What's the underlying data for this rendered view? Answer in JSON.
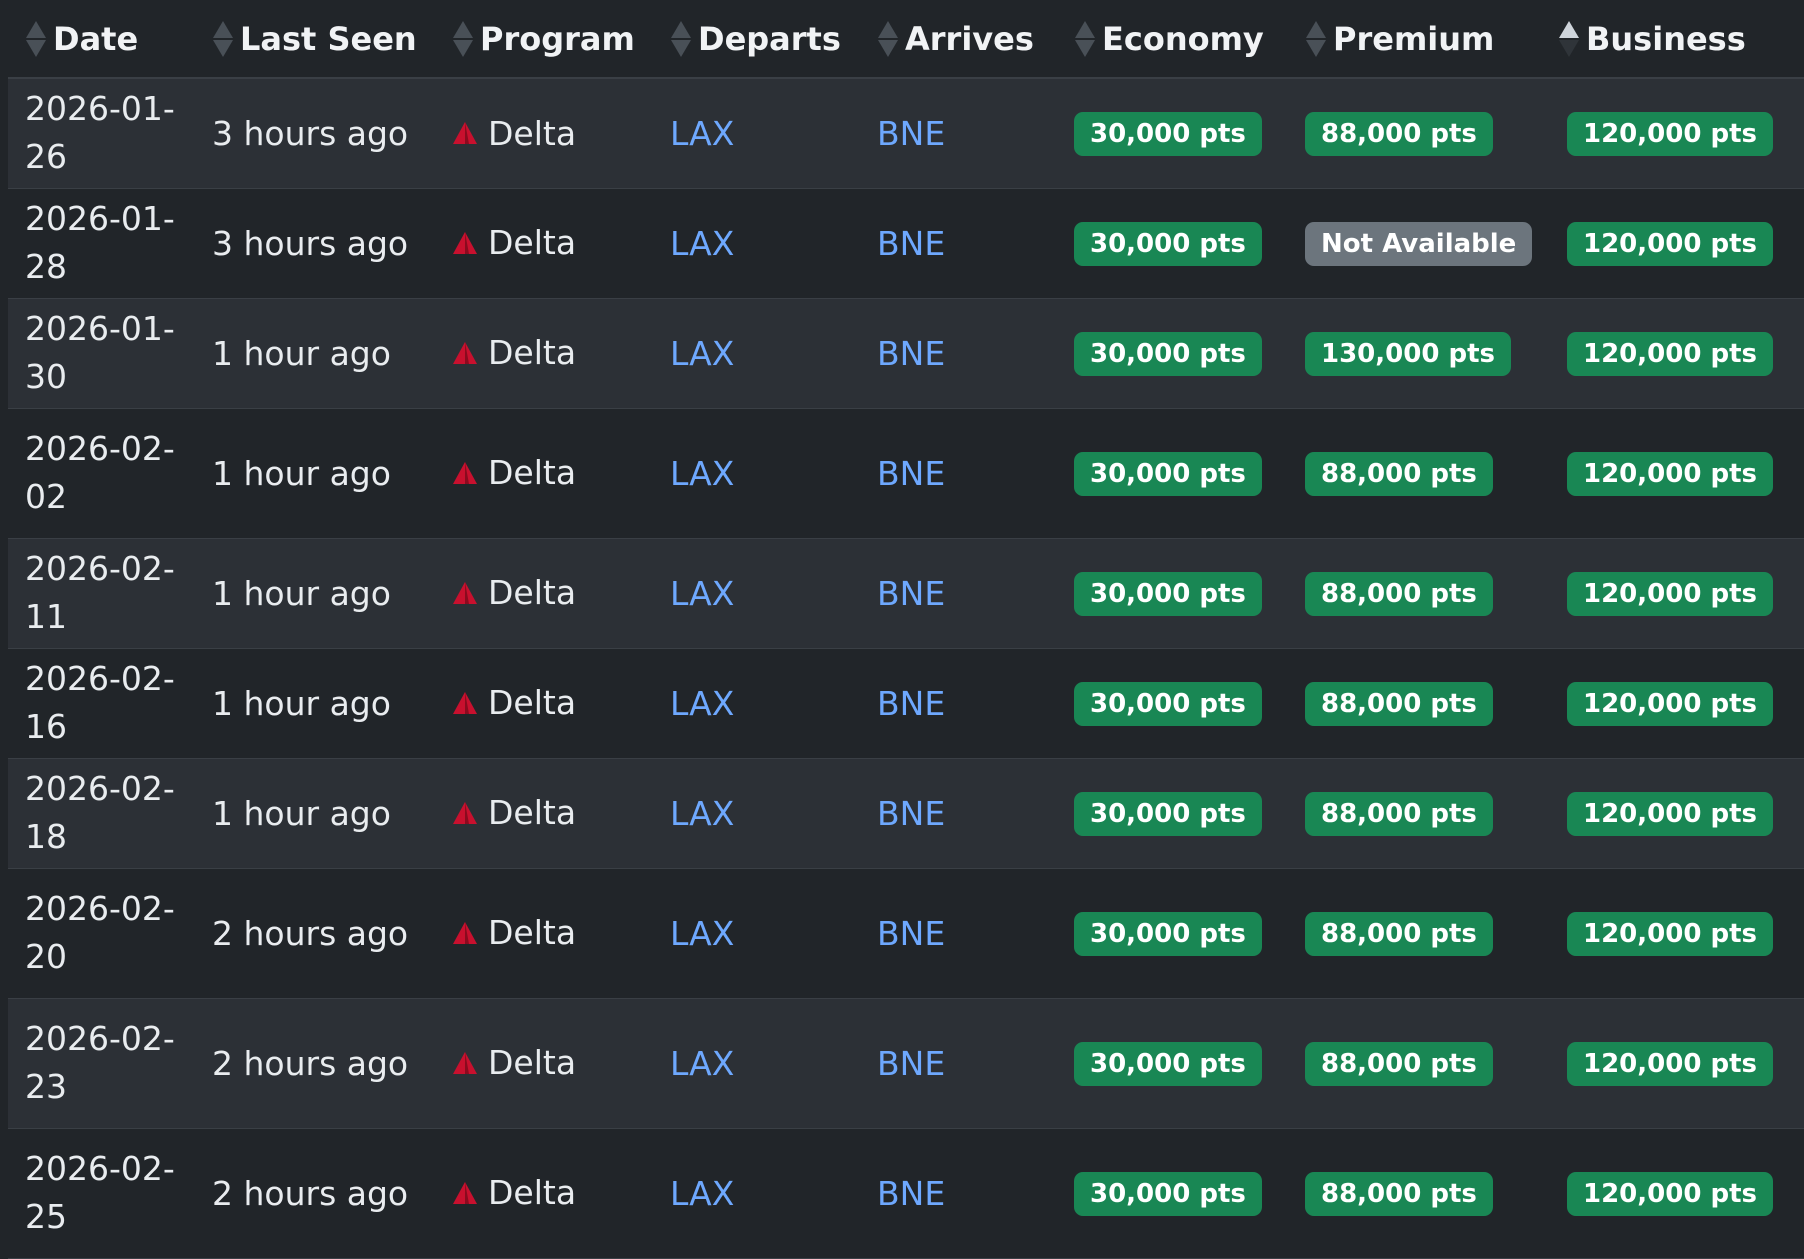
{
  "colors": {
    "background": "#212529",
    "row_alt": "#2c3036",
    "link": "#6ea8fe",
    "badge_available": "#198754",
    "badge_unavailable": "#6c757d",
    "delta_logo": "#c8102e"
  },
  "table": {
    "columns": [
      {
        "label": "Date",
        "sort": "none"
      },
      {
        "label": "Last Seen",
        "sort": "none"
      },
      {
        "label": "Program",
        "sort": "none"
      },
      {
        "label": "Departs",
        "sort": "none"
      },
      {
        "label": "Arrives",
        "sort": "none"
      },
      {
        "label": "Economy",
        "sort": "none"
      },
      {
        "label": "Premium",
        "sort": "none"
      },
      {
        "label": "Business",
        "sort": "ascending"
      }
    ],
    "rows": [
      {
        "date": "2026-01-26",
        "last_seen": "3 hours ago",
        "program": "Delta",
        "program_icon": "delta-logo-icon",
        "departs": "LAX",
        "arrives": "BNE",
        "economy": "30,000 pts",
        "premium": "88,000 pts",
        "business": "120,000 pts"
      },
      {
        "date": "2026-01-28",
        "last_seen": "3 hours ago",
        "program": "Delta",
        "program_icon": "delta-logo-icon",
        "departs": "LAX",
        "arrives": "BNE",
        "economy": "30,000 pts",
        "premium": "Not Available",
        "business": "120,000 pts"
      },
      {
        "date": "2026-01-30",
        "last_seen": "1 hour ago",
        "program": "Delta",
        "program_icon": "delta-logo-icon",
        "departs": "LAX",
        "arrives": "BNE",
        "economy": "30,000 pts",
        "premium": "130,000 pts",
        "business": "120,000 pts"
      },
      {
        "date": "2026-02-02",
        "last_seen": "1 hour ago",
        "program": "Delta",
        "program_icon": "delta-logo-icon",
        "departs": "LAX",
        "arrives": "BNE",
        "economy": "30,000 pts",
        "premium": "88,000 pts",
        "business": "120,000 pts"
      },
      {
        "date": "2026-02-11",
        "last_seen": "1 hour ago",
        "program": "Delta",
        "program_icon": "delta-logo-icon",
        "departs": "LAX",
        "arrives": "BNE",
        "economy": "30,000 pts",
        "premium": "88,000 pts",
        "business": "120,000 pts"
      },
      {
        "date": "2026-02-16",
        "last_seen": "1 hour ago",
        "program": "Delta",
        "program_icon": "delta-logo-icon",
        "departs": "LAX",
        "arrives": "BNE",
        "economy": "30,000 pts",
        "premium": "88,000 pts",
        "business": "120,000 pts"
      },
      {
        "date": "2026-02-18",
        "last_seen": "1 hour ago",
        "program": "Delta",
        "program_icon": "delta-logo-icon",
        "departs": "LAX",
        "arrives": "BNE",
        "economy": "30,000 pts",
        "premium": "88,000 pts",
        "business": "120,000 pts"
      },
      {
        "date": "2026-02-20",
        "last_seen": "2 hours ago",
        "program": "Delta",
        "program_icon": "delta-logo-icon",
        "departs": "LAX",
        "arrives": "BNE",
        "economy": "30,000 pts",
        "premium": "88,000 pts",
        "business": "120,000 pts"
      },
      {
        "date": "2026-02-23",
        "last_seen": "2 hours ago",
        "program": "Delta",
        "program_icon": "delta-logo-icon",
        "departs": "LAX",
        "arrives": "BNE",
        "economy": "30,000 pts",
        "premium": "88,000 pts",
        "business": "120,000 pts"
      },
      {
        "date": "2026-02-25",
        "last_seen": "2 hours ago",
        "program": "Delta",
        "program_icon": "delta-logo-icon",
        "departs": "LAX",
        "arrives": "BNE",
        "economy": "30,000 pts",
        "premium": "88,000 pts",
        "business": "120,000 pts"
      }
    ]
  }
}
